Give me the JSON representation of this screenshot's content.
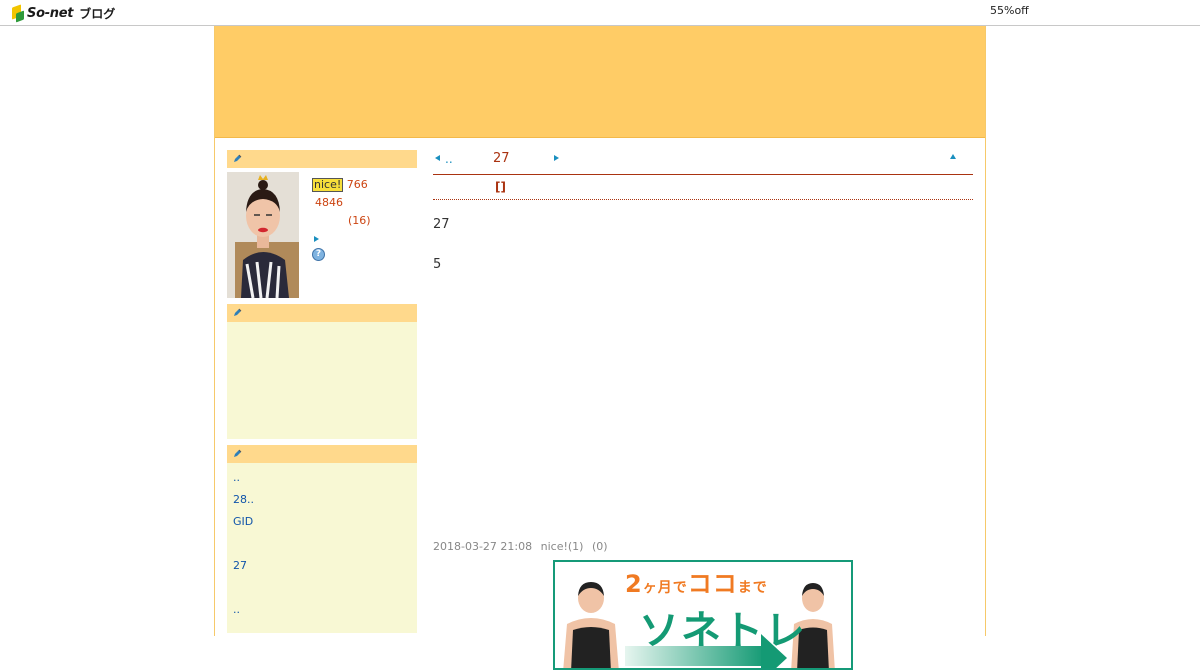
{
  "topbar": {
    "logo_text": "So-net",
    "logo_sub": "ブログ",
    "promo": "55%off"
  },
  "sidebar": {
    "profile": {
      "nice_badge": "nice!",
      "nice_count": "766",
      "count2": "4846",
      "count3": "(16)"
    },
    "help_icon": "?",
    "links": [
      "..",
      "28..",
      "GID",
      "",
      "27",
      "",
      ".."
    ]
  },
  "main": {
    "nav": {
      "prev_label": "..",
      "title": "27"
    },
    "category": "[]",
    "body": [
      "27",
      "5"
    ],
    "meta": {
      "datetime": "2018-03-27 21:08",
      "nice": "nice!(1)",
      "comments": "(0)"
    }
  },
  "ad": {
    "headline_number": "2",
    "headline_text": "ヶ月で",
    "headline_highlight": "ココ",
    "headline_tail": "まで",
    "main_text": "ソネトレ"
  },
  "colors": {
    "banner": "#ffcc66",
    "sidebar_head": "#ffd98c",
    "sidebar_box": "#f8f8d4",
    "accent_red": "#aa3311",
    "link_blue": "#1155aa",
    "ad_green": "#149a74",
    "ad_orange": "#f07a22"
  }
}
